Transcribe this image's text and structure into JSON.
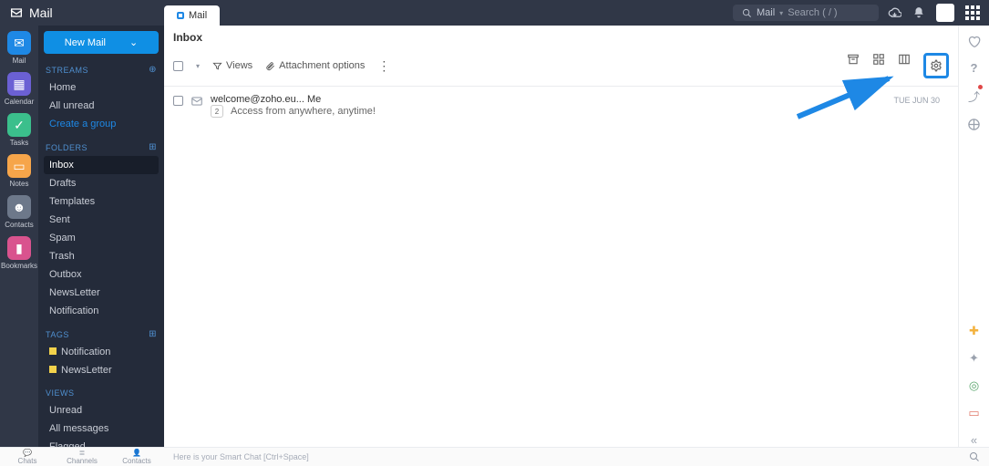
{
  "brand": "Mail",
  "tab_label": "Mail",
  "search_scope": "Mail",
  "search_placeholder": "Search ( / )",
  "rail": [
    {
      "label": "Mail"
    },
    {
      "label": "Calendar"
    },
    {
      "label": "Tasks"
    },
    {
      "label": "Notes"
    },
    {
      "label": "Contacts"
    },
    {
      "label": "Bookmarks"
    }
  ],
  "new_mail": "New Mail",
  "sidebar": {
    "streams_head": "STREAMS",
    "streams": [
      "Home",
      "All unread",
      "Create a group"
    ],
    "folders_head": "FOLDERS",
    "folders": [
      "Inbox",
      "Drafts",
      "Templates",
      "Sent",
      "Spam",
      "Trash",
      "Outbox",
      "NewsLetter",
      "Notification"
    ],
    "tags_head": "TAGS",
    "tags": [
      "Notification",
      "NewsLetter"
    ],
    "views_head": "VIEWS",
    "views": [
      "Unread",
      "All messages",
      "Flagged"
    ]
  },
  "inbox_title": "Inbox",
  "toolbar": {
    "views": "Views",
    "attachment": "Attachment options"
  },
  "mail": {
    "from": "welcome@zoho.eu... Me",
    "subject": "Access from anywhere, anytime!",
    "date": "TUE JUN 30",
    "thread_count": "2"
  },
  "bottom": {
    "tabs": [
      "Chats",
      "Channels",
      "Contacts"
    ],
    "smart": "Here is your Smart Chat [Ctrl+Space]"
  }
}
